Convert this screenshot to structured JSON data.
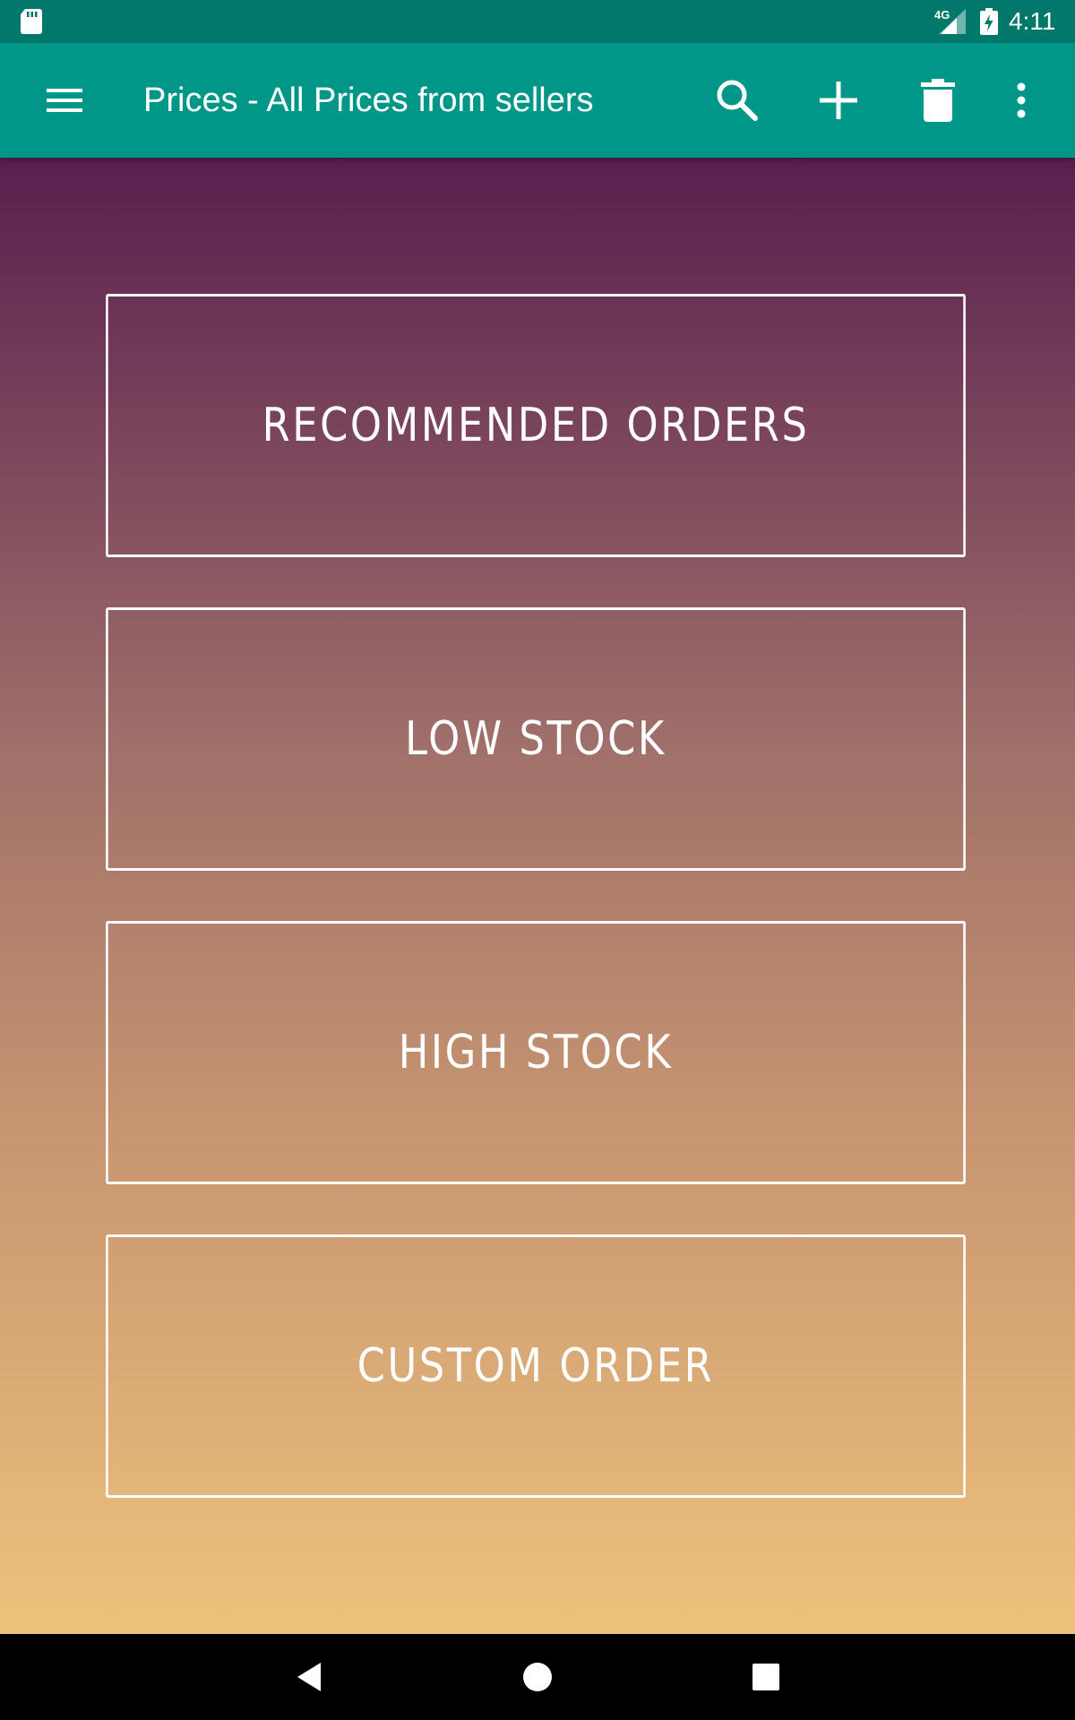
{
  "status_bar": {
    "network": "4G",
    "time": "4:11",
    "icons": [
      "sd-card-icon",
      "signal-icon",
      "battery-charging-icon"
    ]
  },
  "app_bar": {
    "title": "Prices - All Prices from sellers",
    "icons": [
      "menu-icon",
      "search-icon",
      "add-icon",
      "delete-icon",
      "more-vert-icon"
    ]
  },
  "options": [
    {
      "label": "RECOMMENDED ORDERS"
    },
    {
      "label": "LOW STOCK"
    },
    {
      "label": "HIGH STOCK"
    },
    {
      "label": "CUSTOM ORDER"
    }
  ],
  "nav_bar": {
    "icons": [
      "back-icon",
      "home-icon",
      "recents-icon"
    ]
  },
  "colors": {
    "status_bar": "#00796b",
    "app_bar": "#009688",
    "gradient_top": "#591f4f",
    "gradient_bottom": "#eec27c",
    "button_border": "#ffffff"
  }
}
